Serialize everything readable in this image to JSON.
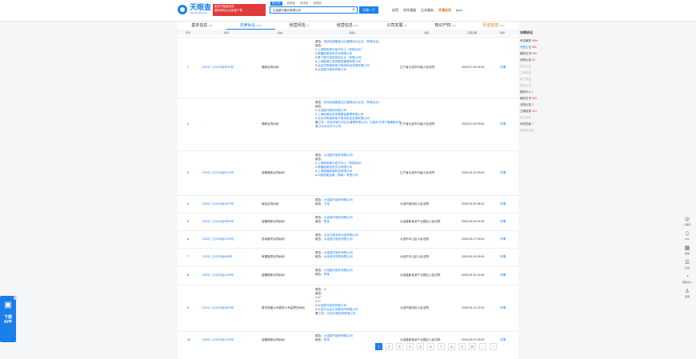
{
  "header": {
    "logo_text": "天眼查",
    "logo_sub": "TianYancha.com",
    "promo_line1": "新生代批量查询",
    "promo_line2": "国际风险企业批量下载",
    "search_tabs": [
      "查公司",
      "查老板",
      "查关系",
      "查风险"
    ],
    "search_value": "大连银行股份有限公司",
    "search_btn": "天眼一下",
    "nav": [
      "应用",
      "合作通道",
      "企业服务",
      "开通会员",
      "tyc4..."
    ]
  },
  "tabs": [
    {
      "label": "基本信息",
      "count": "400"
    },
    {
      "label": "法律诉讼",
      "count": "999+"
    },
    {
      "label": "经营风险",
      "count": "80"
    },
    {
      "label": "经营信息",
      "count": "999+"
    },
    {
      "label": "公司发展",
      "count": "30"
    },
    {
      "label": "知识产权",
      "count": "150"
    },
    {
      "label": "历史信息",
      "count": "999+"
    }
  ],
  "table_headers": [
    "序号",
    "案号",
    "案由",
    "当事人",
    "法院",
    "开庭日期",
    "操作"
  ],
  "rows": [
    {
      "idx": "1",
      "case": "（2024）辽0203民5870号",
      "cause": "借款合同纠纷",
      "parties": [
        {
          "t": "原告：",
          "v": "西安信诚融投企业管理合伙企业（有限合伙）"
        },
        {
          "t": "被告：",
          "v": ""
        },
        {
          "t": "1.",
          "v": "上海新阳城中经济中心（有限合伙）"
        },
        {
          "t": "2.",
          "v": "新疆富景投资文化有限公司"
        },
        {
          "t": "3.",
          "v": "厦门银升投资咨询企业（有限公司）"
        },
        {
          "t": "4.",
          "v": "上海嘉德汇投资基金管理有限公司"
        },
        {
          "t": "5.",
          "v": "北京华联嘉和电子商务科技发展有限公司"
        },
        {
          "t": "6.",
          "v": "大连银行股份有限公司"
        }
      ],
      "court": "辽宁省大连市中级人民法院",
      "date": "2025-07-09 09:00",
      "detail": "详情"
    },
    {
      "idx": "2",
      "case": "-",
      "cause": "借款合同纠纷",
      "parties": [
        {
          "t": "原告：",
          "v": "西安信诚融投企业管理合伙企业（有限合伙）"
        },
        {
          "t": "被告：",
          "v": ""
        },
        {
          "t": "1.",
          "v": "大连银行股份有限公司"
        },
        {
          "t": "2.",
          "v": "上海私募投资发展基金管理有限公司"
        },
        {
          "t": "3.",
          "v": "北京华联嘉和电子商务科技发展有限公司"
        },
        {
          "t": "第三方：",
          "v": "西安农城万村企业管理有限公司，中国东方资产管理股份有限公司北京市分公司"
        }
      ],
      "court": "辽宁省大连市中级人民法院",
      "date": "2025-07-09 09:00",
      "detail": "详情"
    },
    {
      "idx": "3",
      "case": "（2024）辽0203民5313号",
      "cause": "金融借款合同纠纷",
      "parties": [
        {
          "t": "原告：",
          "v": "大连银行股份有限公司"
        },
        {
          "t": "被告：",
          "v": ""
        },
        {
          "t": "1.",
          "v": "上海新阳城中经济中心（有限合伙）"
        },
        {
          "t": "2.",
          "v": "新疆富景投资文化有限公司"
        },
        {
          "t": "3.",
          "v": "上海瑞福智能科技有限公司"
        },
        {
          "t": "4.",
          "v": "中航智能运营（海南）有限公司"
        }
      ],
      "court": "辽宁省大连市中级人民法院",
      "date": "2025-06-10 09:00",
      "detail": "详情"
    },
    {
      "idx": "4",
      "case": "（2025）辽0204民0247号",
      "cause": "保证合同纠纷",
      "parties": [
        {
          "t": "原告：",
          "v": "大连银行股份有限公司"
        },
        {
          "t": "被告：",
          "v": "王某"
        }
      ],
      "court": "大连市西岗区人民法院",
      "date": "2025-06-20 08:40",
      "detail": "详情"
    },
    {
      "idx": "5",
      "case": "（2025）辽0291民9960号",
      "cause": "金融借款合同纠纷",
      "parties": [
        {
          "t": "原告：",
          "v": "大连银行股份有限公司"
        },
        {
          "t": "被告：",
          "v": "陈某"
        }
      ],
      "court": "大连高新技术产业园区人民法院",
      "date": "2025-06-04 09:00",
      "detail": "详情"
    },
    {
      "idx": "6",
      "case": "（2025）辽0203民2294号",
      "cause": "劳动服务合同纠纷",
      "parties": [
        {
          "t": "原告：",
          "v": "大连万政劳务派遣有限公司"
        },
        {
          "t": "被告：",
          "v": "大连银行股份有限公司"
        }
      ],
      "court": "大连市中山区人民法院",
      "date": "2025-05-27 09:00",
      "detail": "详情"
    },
    {
      "idx": "7",
      "case": "（2025）辽0203民668号",
      "cause": "房屋租赁合同纠纷",
      "parties": [
        {
          "t": "原告：",
          "v": "大连银行股份有限公司"
        },
        {
          "t": "被告：",
          "v": "大连某市贸易有限公司"
        }
      ],
      "court": "大连市中山区人民法院",
      "date": "2025-05-26 09:00",
      "detail": "详情"
    },
    {
      "idx": "8",
      "case": "（2025）辽0291民4130号",
      "cause": "金融借款合同纠纷",
      "parties": [
        {
          "t": "原告：",
          "v": "大连银行股份有限公司"
        },
        {
          "t": "被告：",
          "v": "罗某"
        }
      ],
      "court": "大连高新技术产业园区人民法院",
      "date": "2025-05-20 10:00",
      "detail": "详情"
    },
    {
      "idx": "9",
      "case": "（2024）辽0204民4563号",
      "cause": "股东损害公司债权人利益责任纠纷",
      "parties": [
        {
          "t": "原告：",
          "v": "Z*"
        },
        {
          "t": "被告：",
          "v": ""
        },
        {
          "t": "1.",
          "v": "W*"
        },
        {
          "t": "2.",
          "v": "S*"
        },
        {
          "t": "3.",
          "v": "大连银行股份有限公司"
        },
        {
          "t": "4.",
          "v": "大连万合会计师事务所有限公司"
        },
        {
          "t": "第三方：",
          "v": "大连丰缘投资有限公司"
        }
      ],
      "court": "大连市西岗区人民法院",
      "date": "2025-05-13 13:30",
      "detail": "详情"
    },
    {
      "idx": "10",
      "case": "（2025）辽0291民4791号",
      "cause": "金融借款合同纠纷",
      "parties": [
        {
          "t": "原告：",
          "v": "大连银行股份有限公司"
        },
        {
          "t": "被告：",
          "v": "陈某"
        }
      ],
      "court": "大连高新技术产业园区人民法院",
      "date": "2025-05-07 09:00",
      "detail": "详情"
    }
  ],
  "pagination": [
    "1",
    "2",
    "3",
    "4",
    "5",
    "6",
    "7",
    "8",
    "9",
    "10",
    "...",
    "›"
  ],
  "side_nav": {
    "title": "法律诉讼",
    "items": [
      {
        "label": "司法案件",
        "count": "999+",
        "state": "normal"
      },
      {
        "label": "开庭公告",
        "count": "951",
        "state": "active"
      },
      {
        "label": "裁判文书",
        "count": "999",
        "state": "normal"
      },
      {
        "label": "法院公告",
        "count": "29",
        "state": "normal"
      },
      {
        "label": "送达公告",
        "count": "",
        "state": "dim"
      },
      {
        "label": "立案信息",
        "count": "",
        "state": "dim"
      },
      {
        "label": "破产重整",
        "count": "",
        "state": "dim"
      },
      {
        "label": "限制出境",
        "count": "",
        "state": "dim"
      },
      {
        "label": "被执行人",
        "count": "1",
        "state": "normal"
      },
      {
        "label": "裁判文书",
        "count": "183",
        "state": "normal"
      },
      {
        "label": "法院公告",
        "count": "2",
        "state": "normal"
      },
      {
        "label": "立案信息",
        "count": "419",
        "state": "normal"
      },
      {
        "label": "终本案件",
        "count": "",
        "state": "dim"
      },
      {
        "label": "司法拍卖",
        "count": "7",
        "state": "normal"
      },
      {
        "label": "限制高消费",
        "count": "",
        "state": "dim"
      }
    ]
  },
  "right_tools": [
    {
      "icon": "◎",
      "label": "小程序"
    },
    {
      "icon": "▯",
      "label": "APP"
    },
    {
      "icon": "▦",
      "label": "微信"
    },
    {
      "icon": "☰",
      "label": "反馈"
    },
    {
      "icon": "◔",
      "label": "帮助中心"
    },
    {
      "icon": "♙",
      "label": "客服"
    }
  ],
  "app_float": {
    "icon": "▣",
    "label1": "下载",
    "label2": "APP",
    "close": "×"
  }
}
